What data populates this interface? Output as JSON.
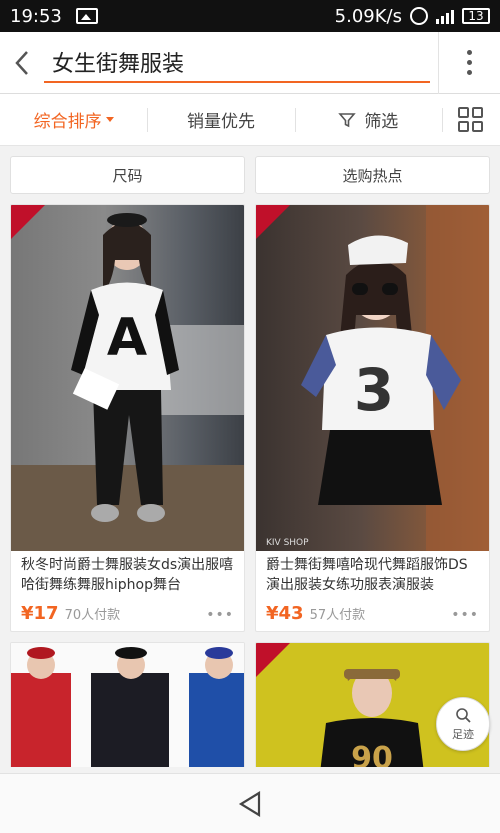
{
  "status_bar": {
    "time": "19:53",
    "speed": "5.09K/s",
    "battery": "13"
  },
  "search": {
    "query": "女生街舞服装"
  },
  "sort_tabs": [
    {
      "label": "综合排序",
      "active": true
    },
    {
      "label": "销量优先",
      "active": false
    },
    {
      "label": "筛选",
      "active": false
    }
  ],
  "filter_chips": [
    "尺码",
    "选购热点"
  ],
  "products": [
    {
      "title": "秋冬时尚爵士舞服装女ds演出服嘻哈街舞练舞服hiphop舞台",
      "price": "¥17",
      "paid": "70人付款",
      "image_text": "A"
    },
    {
      "title": "爵士舞街舞嘻哈现代舞蹈服饰DS演出服装女练功服表演服装",
      "price": "¥43",
      "paid": "57人付款",
      "image_text": "3",
      "watermark": "KIV SHOP"
    },
    {
      "title": "",
      "price": "",
      "paid": ""
    },
    {
      "title": "",
      "price": "",
      "paid": ""
    }
  ],
  "footprint_label": "足迹",
  "colors": {
    "accent": "#f26522",
    "badge": "#c0102a"
  }
}
